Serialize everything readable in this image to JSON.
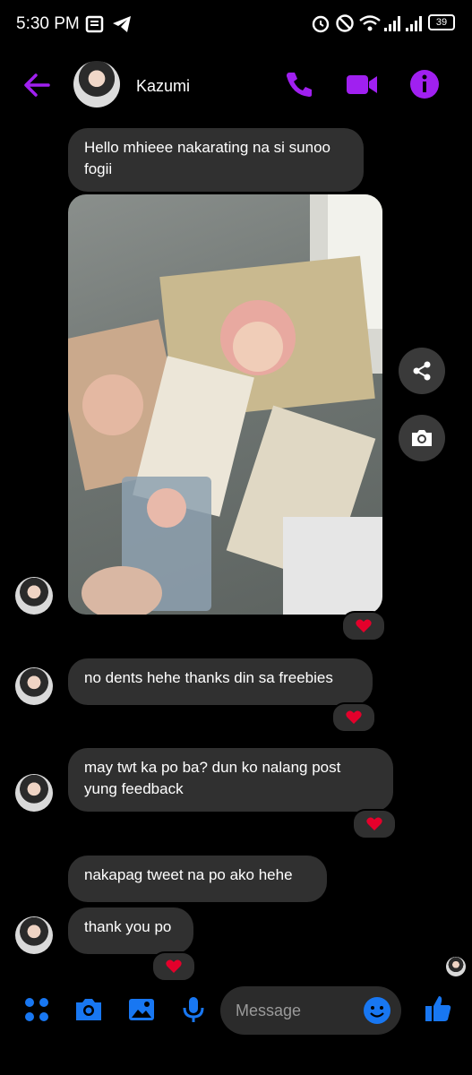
{
  "status_bar": {
    "time": "5:30 PM",
    "battery": "39",
    "icons_left": [
      "notes-icon",
      "telegram-icon"
    ],
    "icons_right": [
      "alarm-icon",
      "dnd-icon",
      "wifi-icon",
      "signal-icon",
      "signal-icon",
      "battery-icon"
    ]
  },
  "header": {
    "contact_name": "Kazumi",
    "accent_color": "#A020F0",
    "buttons": [
      "back-arrow-icon",
      "phone-icon",
      "video-icon",
      "info-icon"
    ]
  },
  "messages": [
    {
      "text": "Hello mhieee nakarating na si sunoo fogii"
    },
    {
      "type": "photo",
      "reaction": "heart"
    },
    {
      "text": "no dents hehe thanks din sa freebies",
      "reaction": "heart"
    },
    {
      "text": "may twt ka po ba? dun ko nalang post yung feedback",
      "reaction": "heart"
    },
    {
      "text": "nakapag tweet na po ako hehe"
    },
    {
      "text": "thank you po",
      "reaction": "heart"
    }
  ],
  "photo_actions": [
    "share-icon",
    "camera-icon"
  ],
  "composer": {
    "placeholder": "Message",
    "accent_color": "#1877F2",
    "icons": [
      "grid-icon",
      "camera-icon",
      "gallery-icon",
      "mic-icon",
      "emoji-icon",
      "thumbs-up-icon"
    ]
  },
  "colors": {
    "background": "#000000",
    "bubble": "#303030",
    "heart": "#E4002B"
  }
}
